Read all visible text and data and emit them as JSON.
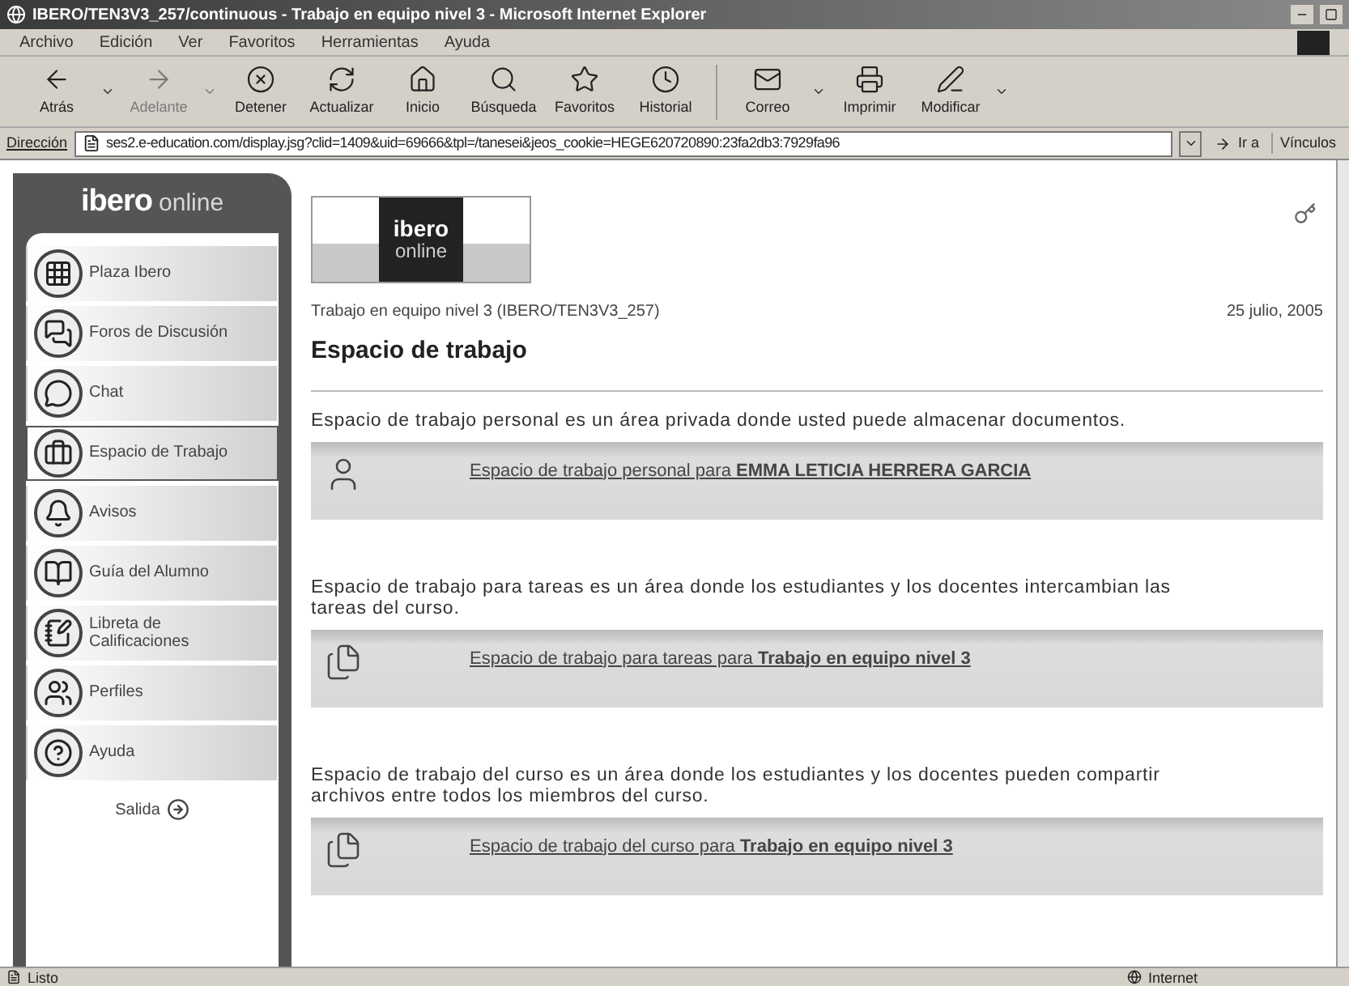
{
  "window": {
    "title": "IBERO/TEN3V3_257/continuous - Trabajo en equipo nivel 3 - Microsoft Internet Explorer"
  },
  "menu": [
    "Archivo",
    "Edición",
    "Ver",
    "Favoritos",
    "Herramientas",
    "Ayuda"
  ],
  "toolbar": [
    {
      "label": "Atrás",
      "kind": "back",
      "disabled": false,
      "dropdown": true
    },
    {
      "label": "Adelante",
      "kind": "forward",
      "disabled": true,
      "dropdown": true
    },
    {
      "label": "Detener",
      "kind": "stop",
      "disabled": false,
      "dropdown": false
    },
    {
      "label": "Actualizar",
      "kind": "refresh",
      "disabled": false,
      "dropdown": false
    },
    {
      "label": "Inicio",
      "kind": "home",
      "disabled": false,
      "dropdown": false
    },
    {
      "label": "Búsqueda",
      "kind": "search",
      "disabled": false,
      "dropdown": false
    },
    {
      "label": "Favoritos",
      "kind": "favorites",
      "disabled": false,
      "dropdown": false
    },
    {
      "label": "Historial",
      "kind": "history",
      "disabled": false,
      "dropdown": false
    },
    {
      "label": "Correo",
      "kind": "mail",
      "disabled": false,
      "dropdown": true
    },
    {
      "label": "Imprimir",
      "kind": "print",
      "disabled": false,
      "dropdown": false
    },
    {
      "label": "Modificar",
      "kind": "edit",
      "disabled": false,
      "dropdown": true
    }
  ],
  "address": {
    "label": "Dirección",
    "value": "ses2.e-education.com/display.jsg?clid=1409&uid=69666&tpl=/tanesei&jeos_cookie=HEGE620720890:23fa2db3:7929fa96",
    "go": "Ir a",
    "links": "Vínculos"
  },
  "sidebar": {
    "logo": {
      "main": "ibero",
      "sub": "online"
    },
    "items": [
      {
        "label": "Plaza Ibero",
        "kind": "plaza",
        "selected": false
      },
      {
        "label": "Foros de Discusión",
        "kind": "forums",
        "selected": false
      },
      {
        "label": "Chat",
        "kind": "chat",
        "selected": false
      },
      {
        "label": "Espacio de Trabajo",
        "kind": "workspace",
        "selected": true
      },
      {
        "label": "Avisos",
        "kind": "notices",
        "selected": false
      },
      {
        "label": "Guía del Alumno",
        "kind": "guide",
        "selected": false
      },
      {
        "label": "Libreta de Calificaciones",
        "kind": "grades",
        "selected": false
      },
      {
        "label": "Perfiles",
        "kind": "profiles",
        "selected": false
      },
      {
        "label": "Ayuda",
        "kind": "help",
        "selected": false
      }
    ],
    "exit": "Salida"
  },
  "page": {
    "logo": {
      "main": "ibero",
      "sub": "online"
    },
    "course": "Trabajo en equipo nivel 3 (IBERO/TEN3V3_257)",
    "date": "25 julio, 2005",
    "heading": "Espacio de trabajo",
    "sections": [
      {
        "description": "Espacio de trabajo personal es un área privada donde usted puede almacenar documentos.",
        "link": "Espacio de trabajo personal para **EMMA LETICIA HERRERA GARCIA**",
        "kind": "person"
      },
      {
        "description": "Espacio de trabajo para tareas es un área donde los estudiantes y los docentes intercambian las tareas del curso.",
        "link": "Espacio de trabajo para tareas para **Trabajo en equipo nivel 3**",
        "kind": "folders"
      },
      {
        "description": "Espacio de trabajo del curso es un área donde los estudiantes y los docentes pueden compartir archivos entre todos los miembros del curso.",
        "link": "Espacio de trabajo del curso para **Trabajo en equipo nivel 3**",
        "kind": "folders"
      }
    ]
  },
  "status_bar": {
    "text": "Listo",
    "zone": "Internet"
  }
}
